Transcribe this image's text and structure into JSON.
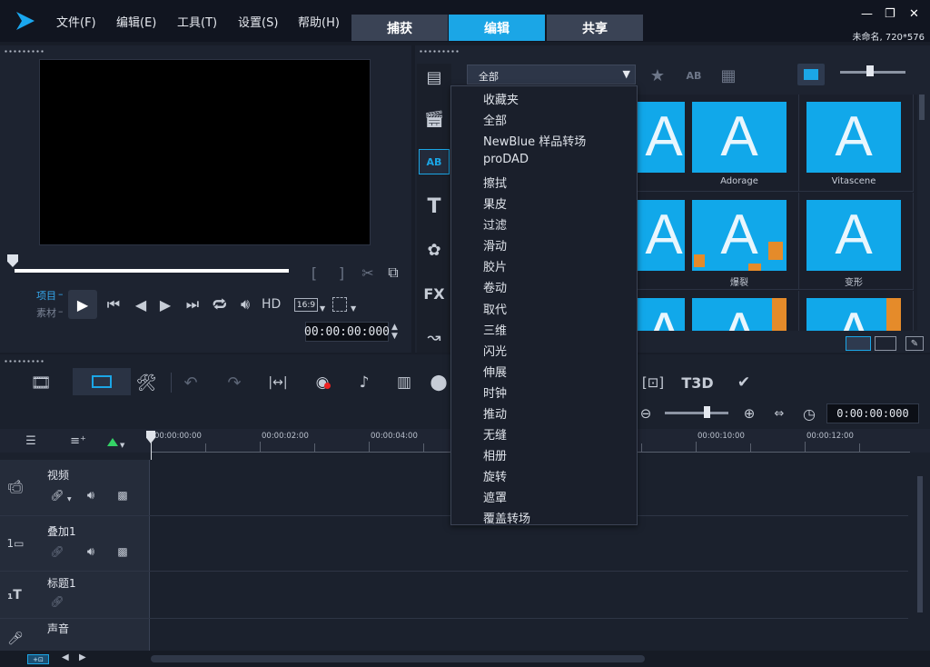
{
  "menu": {
    "file": "文件(F)",
    "edit": "编辑(E)",
    "tools": "工具(T)",
    "settings": "设置(S)",
    "help": "帮助(H)"
  },
  "workspace_tabs": {
    "capture": "捕获",
    "edit": "编辑",
    "share": "共享"
  },
  "window": {
    "project_info": "未命名, 720*576"
  },
  "player": {
    "project_label": "项目",
    "clip_label": "素材",
    "hd_label": "HD",
    "aspect": "16:9",
    "timecode": "00:00:00:000"
  },
  "library": {
    "filter_value": "全部"
  },
  "filter_options": [
    "收藏夹",
    "全部",
    "NewBlue 样品转场",
    "proDAD",
    "擦拭",
    "果皮",
    "过滤",
    "滑动",
    "胶片",
    "卷动",
    "取代",
    "三维",
    "闪光",
    "伸展",
    "时钟",
    "推动",
    "无缝",
    "相册",
    "旋转",
    "遮罩",
    "覆盖转场"
  ],
  "thumbnails": [
    {
      "label": "Adorage"
    },
    {
      "label": "Vitascene"
    },
    {
      "label": "爆裂"
    },
    {
      "label": "变形"
    }
  ],
  "timeline": {
    "zoom_timecode": "0:00:00:000",
    "ruler": [
      "00:00:00:00",
      "00:00:02:00",
      "00:00:04:00",
      "00:00:10:00",
      "00:00:12:00"
    ],
    "tracks": {
      "video": "视频",
      "overlay": "叠加1",
      "title": "标题1",
      "voice": "声音"
    }
  }
}
